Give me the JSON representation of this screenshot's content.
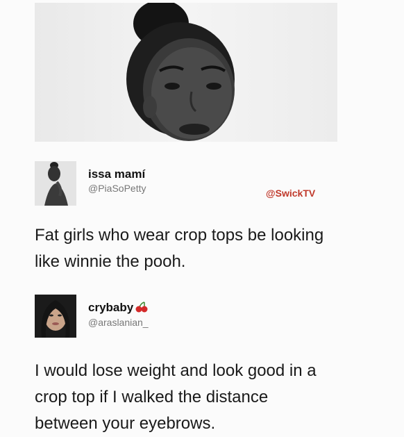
{
  "tweet1": {
    "display_name": "issa mamí",
    "handle": "@PiaSoPetty",
    "watermark": "@SwickTV",
    "text_line1": "Fat girls who wear crop tops be looking",
    "text_line2": "like winnie the pooh."
  },
  "tweet2": {
    "display_name": "crybaby",
    "name_emoji_icon": "cherries-icon",
    "handle": "@araslanian_",
    "text_line1": "I would lose weight and look good in a",
    "text_line2": "crop top if I walked the distance",
    "text_line3": "between your eyebrows."
  },
  "colors": {
    "background": "#fbfbfb",
    "handle": "#777777",
    "watermark": "#c0392b"
  }
}
